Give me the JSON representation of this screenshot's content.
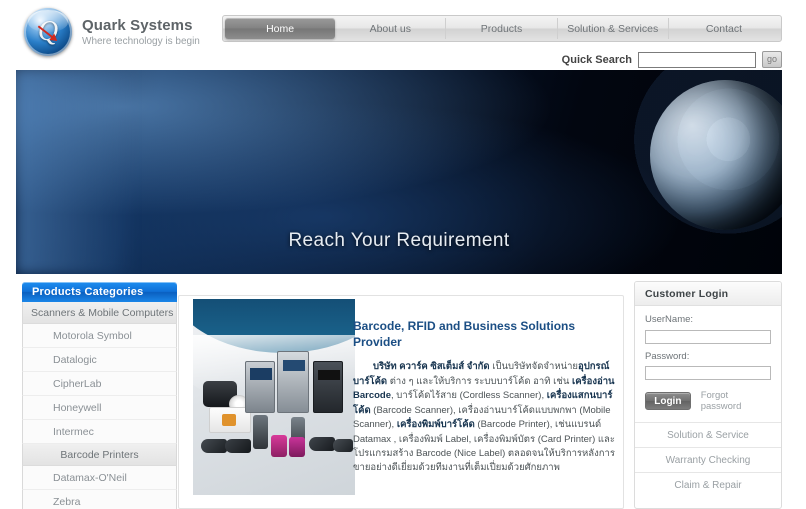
{
  "brand": {
    "name": "Quark Systems",
    "tagline": "Where technology is begin",
    "logo_icon": "quark-logo-icon"
  },
  "nav": {
    "items": [
      {
        "label": "Home",
        "active": true
      },
      {
        "label": "About us",
        "active": false
      },
      {
        "label": "Products",
        "active": false
      },
      {
        "label": "Solution & Services",
        "active": false
      },
      {
        "label": "Contact",
        "active": false
      }
    ]
  },
  "search": {
    "label": "Quick Search",
    "value": "",
    "placeholder": "",
    "button_label": "go"
  },
  "banner": {
    "title": "Reach Your Requirement",
    "image_name": "earth-and-moon-space-banner"
  },
  "sidebar": {
    "header": "Products Categories",
    "blocks": [
      {
        "group": "Scanners & Mobile Computers",
        "align": "left",
        "items": [
          "Motorola Symbol",
          "Datalogic",
          "CipherLab",
          "Honeywell",
          "Intermec"
        ]
      },
      {
        "group": "Barcode Printers",
        "align": "center",
        "items": [
          "Datamax-O'Neil",
          "Zebra"
        ]
      }
    ]
  },
  "main": {
    "promo_image_name": "barcode-products-collage",
    "title": "Barcode, RFID and Business Solutions Provider",
    "body_html": "<b>บริษัท ควาร์ค ซิสเต็มส์ จำกัด</b> เป็นบริษัทจัดจำหน่าย<b>อุปกรณ์บาร์โค้ด</b> ต่าง ๆ และให้บริการ ระบบบาร์โค้ด อาทิ เช่น <b>เครื่องอ่าน Barcode</b>, บาร์โค้ดไร้สาย (Cordless Scanner), <b>เครื่องแสกนบาร์โค้ด</b> (Barcode Scanner), เครื่องอ่านบาร์โค้ดแบบพกพา (Mobile Scanner), <b>เครื่องพิมพ์บาร์โค้ด</b> (Barcode Printer), เช่นแบรนด์ Datamax , เครื่องพิมพ์ Label, เครื่องพิมพ์บัตร (Card Printer) และโปรแกรมสร้าง Barcode (Nice Label) ตลอดจนให้บริการหลังการขายอย่างดีเยี่ยมด้วยทีมงานที่เต็มเปี่ยมด้วยศักยภาพ"
  },
  "login": {
    "header": "Customer Login",
    "username_label": "UserName:",
    "username_value": "",
    "password_label": "Password:",
    "password_value": "",
    "submit_label": "Login",
    "forgot_label": "Forgot password"
  },
  "rail_links": [
    "Solution & Service",
    "Warranty Checking",
    "Claim & Repair"
  ],
  "colors": {
    "brand_blue": "#0f6fd6",
    "heading_blue": "#1b4e84",
    "nav_active": "#767676",
    "banner_dark": "#020610"
  }
}
